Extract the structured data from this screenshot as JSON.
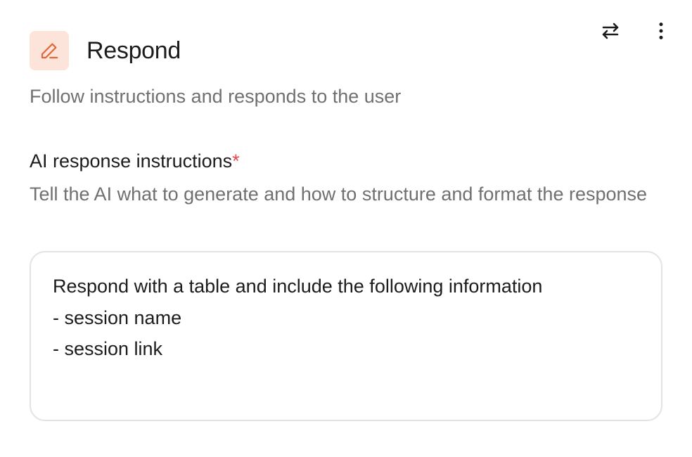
{
  "step": {
    "title": "Respond",
    "subtitle": "Follow instructions and responds to the user",
    "icon": "pencil-icon",
    "icon_color": "#e0673b",
    "icon_bg": "#fde4da"
  },
  "actions": {
    "swap_icon": "swap-arrows-icon",
    "more_icon": "more-vertical-icon"
  },
  "field": {
    "label": "AI response instructions",
    "required_mark": "*",
    "required_color": "#e5484d",
    "help": "Tell the AI what to generate and how to structure and format the response",
    "value_lines": [
      "Respond with a table and include the following information",
      "- session name",
      "- session link"
    ]
  }
}
